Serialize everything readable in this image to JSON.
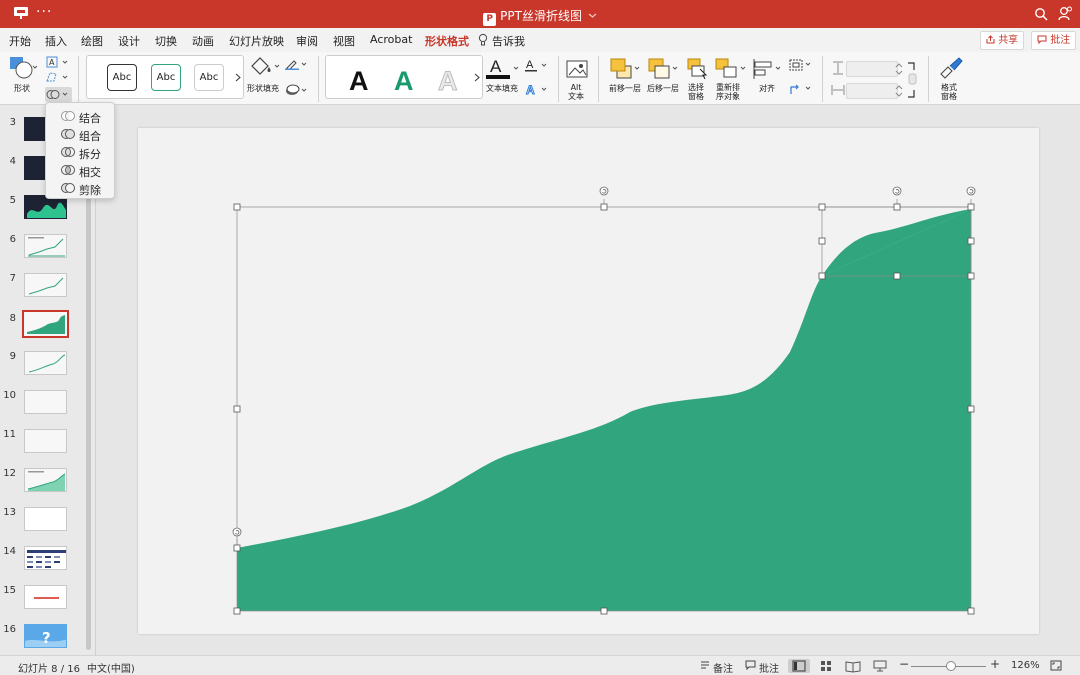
{
  "window": {
    "title": "PPT丝滑折线图"
  },
  "tabs": [
    {
      "label": "开始",
      "active": false
    },
    {
      "label": "插入",
      "active": false
    },
    {
      "label": "绘图",
      "active": false
    },
    {
      "label": "设计",
      "active": false
    },
    {
      "label": "切换",
      "active": false
    },
    {
      "label": "动画",
      "active": false
    },
    {
      "label": "幻灯片放映",
      "active": false
    },
    {
      "label": "审阅",
      "active": false
    },
    {
      "label": "视图",
      "active": false
    },
    {
      "label": "Acrobat",
      "active": false
    },
    {
      "label": "形状格式",
      "active": true
    }
  ],
  "tell_me": {
    "label": "告诉我"
  },
  "actions": {
    "share": "共享",
    "comment": "批注"
  },
  "ribbon": {
    "shape_label": "形状",
    "style_samples": [
      "Abc",
      "Abc",
      "Abc"
    ],
    "shape_fill_label": "形状填充",
    "wordart_letters": [
      "A",
      "A",
      "A"
    ],
    "text_fill_label": "文本填充",
    "alt_text_label": "Alt\n文本",
    "bring_forward_label": "前移一层",
    "send_backward_label": "后移一层",
    "selection_pane_label": "选择\n窗格",
    "reorder_label": "重新排\n序对象",
    "align_label": "对齐",
    "format_pane_label": "格式\n窗格"
  },
  "merge_menu": {
    "items": [
      {
        "label": "结合",
        "icon": "combine-icon"
      },
      {
        "label": "组合",
        "icon": "union-icon"
      },
      {
        "label": "拆分",
        "icon": "fragment-icon"
      },
      {
        "label": "相交",
        "icon": "intersect-icon"
      },
      {
        "label": "剪除",
        "icon": "subtract-icon"
      }
    ]
  },
  "slides": {
    "numbers": [
      "3",
      "4",
      "5",
      "6",
      "7",
      "8",
      "9",
      "10",
      "11",
      "12",
      "13",
      "14",
      "15",
      "16"
    ],
    "current": "8"
  },
  "colors": {
    "accent": "#c9362a",
    "shape_fill": "#31a57e",
    "slide_bg": "#f2f2f2"
  },
  "statusbar": {
    "slide_info": "幻灯片 8 / 16",
    "language": "中文(中国)",
    "notes_label": "备注",
    "comments_label": "批注",
    "zoom": "126%"
  }
}
